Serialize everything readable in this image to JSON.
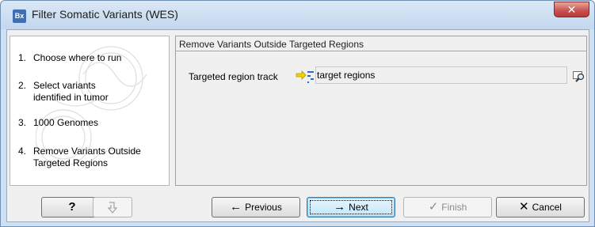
{
  "window": {
    "title": "Filter Somatic Variants (WES)",
    "app_icon_text": "Bx",
    "close_glyph": "✕"
  },
  "steps": [
    {
      "num": "1.",
      "label": "Choose where to run"
    },
    {
      "num": "2.",
      "label": "Select variants identified in tumor"
    },
    {
      "num": "3.",
      "label": "1000 Genomes"
    },
    {
      "num": "4.",
      "label": "Remove Variants Outside Targeted Regions"
    }
  ],
  "panel": {
    "title": "Remove Variants Outside Targeted Regions",
    "field_label": "Targeted region track",
    "field_value": "target regions",
    "track_icon": "annotation-track-icon",
    "browse_icon": "browse-magnifier-icon"
  },
  "buttons": {
    "help": "?",
    "help_icon": "question-mark-icon",
    "reset_icon": "reset-icon",
    "previous": "Previous",
    "previous_glyph": "←",
    "next": "Next",
    "next_glyph": "→",
    "finish": "Finish",
    "finish_glyph": "✓",
    "cancel": "Cancel",
    "cancel_glyph": "✕"
  },
  "colors": {
    "title_bar": "#c3d7ee",
    "close_button": "#c75050",
    "track_icon_yellow": "#e6c700",
    "default_button": "#bee6fd"
  }
}
